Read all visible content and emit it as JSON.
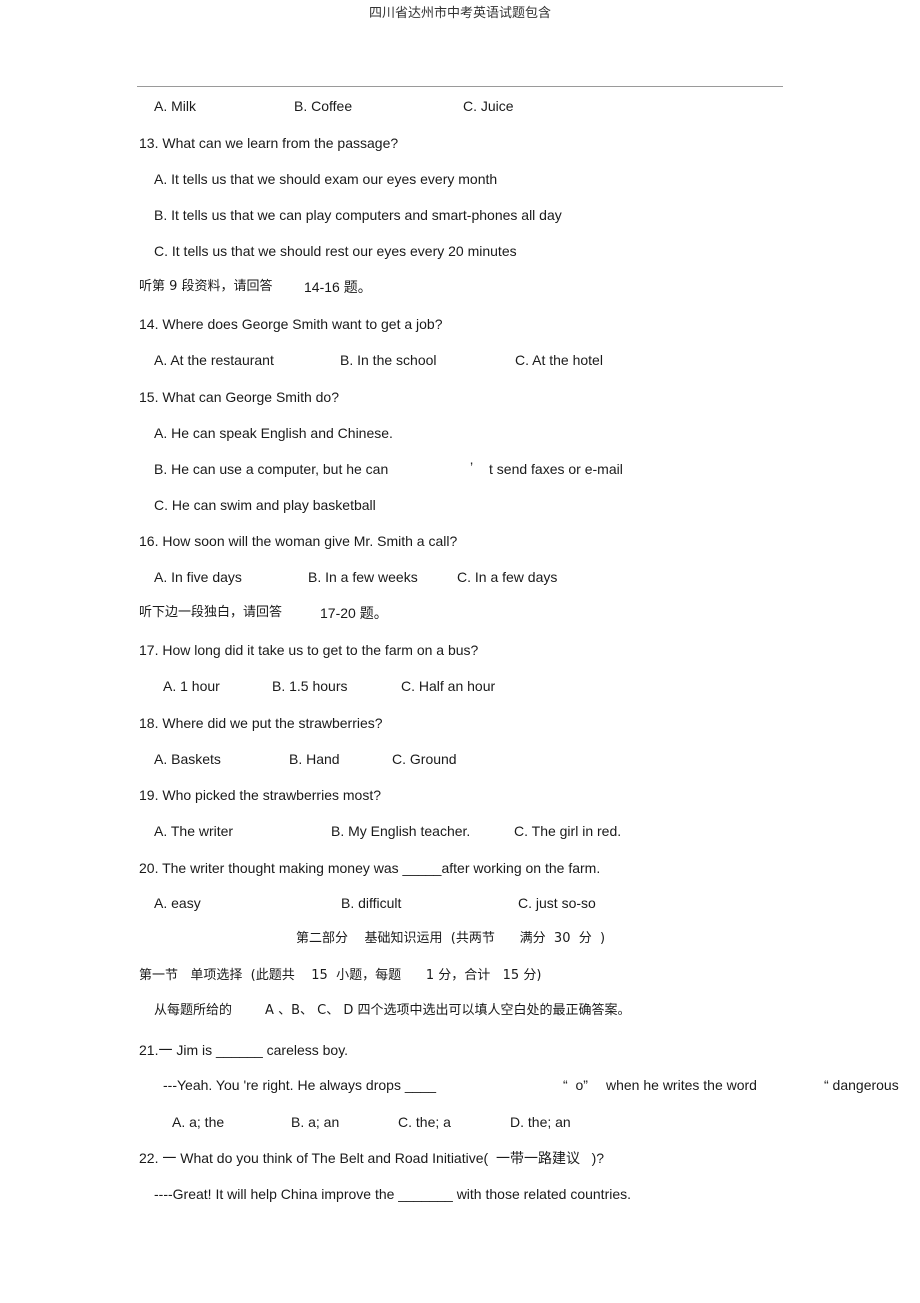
{
  "header": {
    "title": "四川省达州市中考英语试题包含"
  },
  "q12": {
    "options": [
      "A. Milk",
      "B. Coffee",
      "C. Juice"
    ]
  },
  "q13": {
    "question": "13. What can we learn from the passage?",
    "options": [
      "A. It tells us that we should exam our eyes every month",
      "B. It tells us that we can play computers and smart-phones all day",
      "C. It tells us that we should rest our eyes every 20 minutes"
    ]
  },
  "instruction1": {
    "text1": "听第 9 段资料，请回答",
    "text2": "14-16 题。"
  },
  "q14": {
    "question": "14. Where does George Smith want to get a job?",
    "options": [
      "A. At the restaurant",
      "B. In the school",
      "C. At the hotel"
    ]
  },
  "q15": {
    "question": "15. What can George Smith do?",
    "options": [
      "A. He can speak English and Chinese.",
      "B. He can use a computer, but he can",
      "’",
      "t send faxes or e-mail",
      "C. He can swim and play basketball"
    ]
  },
  "q16": {
    "question": "16. How soon will the woman give Mr. Smith a call?",
    "options": [
      "A. In five days",
      "B. In a few weeks",
      "C. In a few days"
    ]
  },
  "instruction2": {
    "text1": "听下边一段独白，请回答",
    "text2": "17-20 题。"
  },
  "q17": {
    "question": "17. How long did it take us to get to the farm on a bus?",
    "options": [
      "A. 1 hour",
      "B. 1.5 hours",
      "C. Half an hour"
    ]
  },
  "q18": {
    "question": "18. Where did we put the strawberries?",
    "options": [
      "A. Baskets",
      "B. Hand",
      "C. Ground"
    ]
  },
  "q19": {
    "question": "19. Who picked the strawberries most?",
    "options": [
      "A. The writer",
      "B. My English teacher.",
      "C. The girl in red."
    ]
  },
  "q20": {
    "question": "20. The writer thought making money was _____after working on the farm.",
    "options": [
      "A. easy",
      "B. difficult",
      "C. just so-so"
    ]
  },
  "part2": {
    "heading": "第二部分    基础知识运用  (共两节      满分  30  分  )",
    "section1": "第一节   单项选择  (此题共    15  小题，每题      1 分，合计   15 分)",
    "instruction": "从每题所给的        A 、B、 C、 D 四个选项中选出可以填人空白处的最正确答案。"
  },
  "q21": {
    "line1": "21.一 Jim is ______ careless boy.",
    "line2a": "---Yeah. You 're right. He always drops ____",
    "line2b": "“  o”",
    "line2c": "when he writes the word",
    "line2d": "“ dangerous",
    "options": [
      "A. a; the",
      "B. a; an",
      "C. the; a",
      "D. the; an"
    ]
  },
  "q22": {
    "line1": "22. 一 What do you think of The Belt and Road Initiative(  一带一路建议   )?",
    "line2": "----Great! It will help China improve the _______ with those related countries."
  }
}
